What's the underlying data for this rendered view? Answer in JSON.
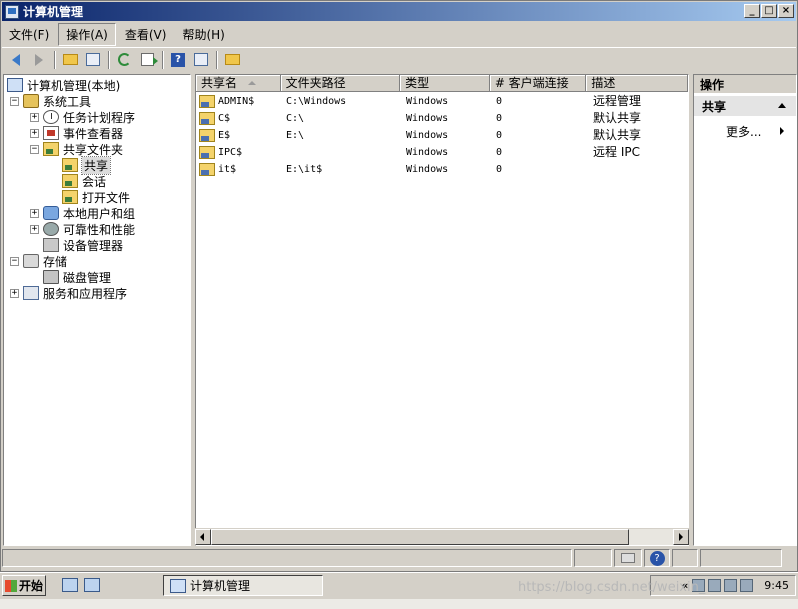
{
  "window": {
    "title": "计算机管理",
    "btn_min": "_",
    "btn_max": "□",
    "btn_close": "×"
  },
  "menu": [
    "文件(F)",
    "操作(A)",
    "查看(V)",
    "帮助(H)"
  ],
  "tree": {
    "root": "计算机管理(本地)",
    "system_tools": "系统工具",
    "task_scheduler": "任务计划程序",
    "event_viewer": "事件查看器",
    "shared_folders": "共享文件夹",
    "shares": "共享",
    "sessions": "会话",
    "open_files": "打开文件",
    "local_users": "本地用户和组",
    "reliability": "可靠性和性能",
    "device_manager": "设备管理器",
    "storage": "存储",
    "disk_management": "磁盘管理",
    "services_apps": "服务和应用程序"
  },
  "list": {
    "columns": [
      "共享名",
      "文件夹路径",
      "类型",
      "# 客户端连接",
      "描述"
    ],
    "rows": [
      {
        "name": "ADMIN$",
        "path": "C:\\Windows",
        "type": "Windows",
        "clients": "0",
        "desc": "远程管理"
      },
      {
        "name": "C$",
        "path": "C:\\",
        "type": "Windows",
        "clients": "0",
        "desc": "默认共享"
      },
      {
        "name": "E$",
        "path": "E:\\",
        "type": "Windows",
        "clients": "0",
        "desc": "默认共享"
      },
      {
        "name": "IPC$",
        "path": "",
        "type": "Windows",
        "clients": "0",
        "desc": "远程 IPC"
      },
      {
        "name": "it$",
        "path": "E:\\it$",
        "type": "Windows",
        "clients": "0",
        "desc": ""
      }
    ]
  },
  "actions": {
    "header": "操作",
    "section": "共享",
    "more": "更多..."
  },
  "taskbar": {
    "start": "开始",
    "task": "计算机管理",
    "time": "9:45",
    "chevron": "«"
  },
  "watermark": "https://blog.csdn.net/weixin_"
}
